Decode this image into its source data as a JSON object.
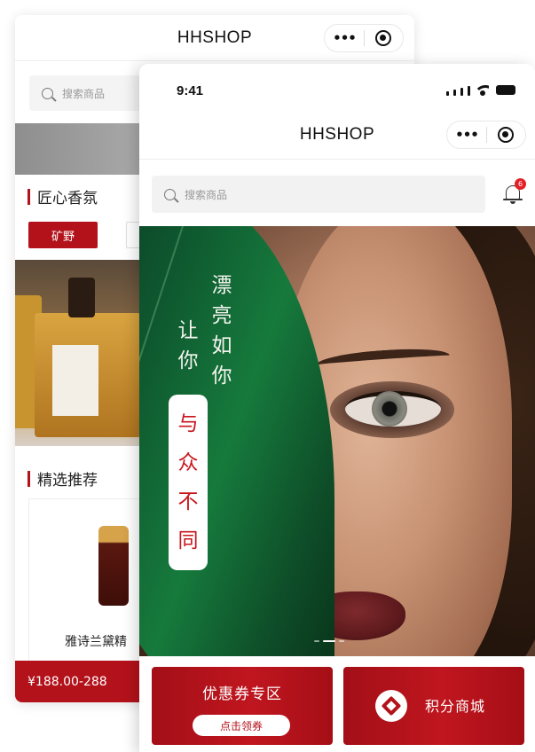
{
  "back_screen": {
    "nav_title": "HHSHOP",
    "search_placeholder": "搜索商品",
    "section_fragrance": "匠心香氛",
    "tag_selected": "矿野",
    "section_recommend": "精选推荐",
    "product_name": "雅诗兰黛精",
    "price": "¥188.00-288"
  },
  "front_screen": {
    "status_time": "9:41",
    "nav_title": "HHSHOP",
    "search_placeholder": "搜索商品",
    "notification_count": "6",
    "banner_poem": {
      "col_right": [
        "漂",
        "亮",
        "如",
        "你"
      ],
      "col_left_top": [
        "让",
        "你"
      ],
      "col_left_highlight": [
        "与",
        "众",
        "不",
        "同"
      ]
    },
    "banner_slide_count": 3,
    "banner_active_slide": 2,
    "coupon_tile": {
      "title": "优惠券专区",
      "button": "点击领券"
    },
    "points_tile": {
      "label": "积分商城"
    }
  },
  "capsule": {
    "more_icon": "more-dots-icon",
    "close_icon": "target-circle-icon"
  },
  "colors": {
    "brand_red": "#b3121b",
    "badge_red": "#e32028",
    "leaf_green": "#0f5a30"
  }
}
